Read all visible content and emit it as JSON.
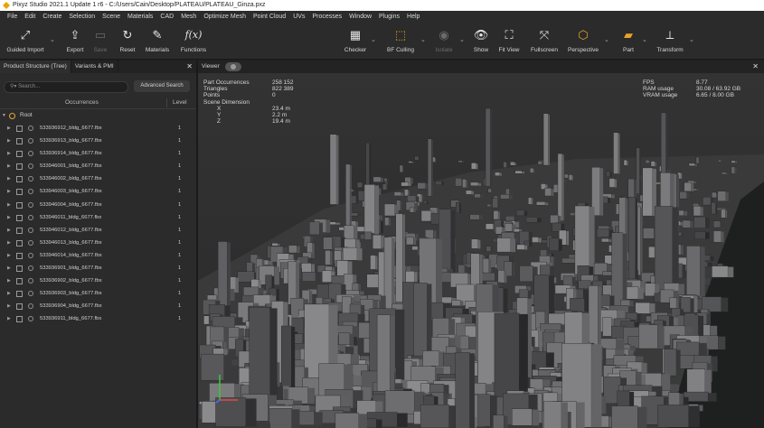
{
  "window": {
    "title": "Pixyz Studio 2021.1 Update 1 r6 - C:/Users/Cain/Desktop/PLATEAU/PLATEAU_Ginza.pxz"
  },
  "menu": [
    "File",
    "Edit",
    "Create",
    "Selection",
    "Scene",
    "Materials",
    "CAD",
    "Mesh",
    "Optimize Mesh",
    "Point Cloud",
    "UVs",
    "Processes",
    "Window",
    "Plugins",
    "Help"
  ],
  "toolbar": {
    "guided_import": "Guided Import",
    "export": "Export",
    "save": "Save",
    "reset": "Reset",
    "materials": "Materials",
    "functions": "Functions",
    "functions_glyph": "f(x)",
    "checker": "Checker",
    "bf_culling": "BF Culling",
    "isolate": "Isolate",
    "show": "Show",
    "fit_view": "Fit View",
    "fullscreen": "Fullscreen",
    "perspective": "Perspective",
    "part": "Part",
    "transform": "Transform"
  },
  "left_panel": {
    "tabs": [
      "Product Structure (Tree)",
      "Variants & PMI"
    ],
    "search_placeholder": "Search...",
    "advanced_search": "Advanced Search",
    "columns": {
      "occurrences": "Occurrences",
      "level": "Level"
    },
    "root": "Root",
    "rows": [
      {
        "name": "533936912_bldg_6677.fbx",
        "level": "1"
      },
      {
        "name": "533936913_bldg_6677.fbx",
        "level": "1"
      },
      {
        "name": "533936914_bldg_6677.fbx",
        "level": "1"
      },
      {
        "name": "533946001_bldg_6677.fbx",
        "level": "1"
      },
      {
        "name": "533946002_bldg_6677.fbx",
        "level": "1"
      },
      {
        "name": "533946003_bldg_6677.fbx",
        "level": "1"
      },
      {
        "name": "533946004_bldg_6677.fbx",
        "level": "1"
      },
      {
        "name": "533946011_bldg_6677.fbx",
        "level": "1"
      },
      {
        "name": "533946012_bldg_6677.fbx",
        "level": "1"
      },
      {
        "name": "533946013_bldg_6677.fbx",
        "level": "1"
      },
      {
        "name": "533946014_bldg_6677.fbx",
        "level": "1"
      },
      {
        "name": "533936901_bldg_6677.fbx",
        "level": "1"
      },
      {
        "name": "533936902_bldg_6677.fbx",
        "level": "1"
      },
      {
        "name": "533936903_bldg_6677.fbx",
        "level": "1"
      },
      {
        "name": "533936904_bldg_6677.fbx",
        "level": "1"
      },
      {
        "name": "533936911_bldg_6677.fbx",
        "level": "1"
      }
    ]
  },
  "viewer": {
    "tab": "Viewer",
    "stats": {
      "part_occ_label": "Part Occurrences",
      "part_occ": "258 152",
      "triangles_label": "Triangles",
      "triangles": "822 389",
      "points_label": "Points",
      "points": "0",
      "scene_dim_label": "Scene Dimension",
      "x_label": "X",
      "x": "23.4 m",
      "y_label": "Y",
      "y": "2.2 m",
      "z_label": "Z",
      "z": "19.4 m"
    },
    "perf": {
      "fps_label": "FPS",
      "fps": "8.77",
      "ram_label": "RAM usage",
      "ram": "30.08 / 63.92 GB",
      "vram_label": "VRAM usage",
      "vram": "6.65 / 8.00 GB"
    }
  },
  "colors": {
    "accent": "#e8a32a",
    "background": "#2c2c2c",
    "panel": "#2b2b2b"
  }
}
